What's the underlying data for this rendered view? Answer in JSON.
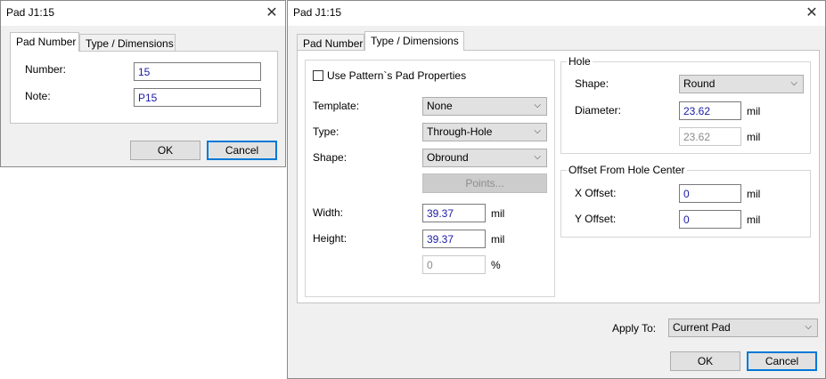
{
  "left_dialog": {
    "title": "Pad J1:15",
    "tabs": [
      "Pad Number",
      "Type / Dimensions"
    ],
    "fields": {
      "number_label": "Number:",
      "number_value": "15",
      "note_label": "Note:",
      "note_value": "P15"
    },
    "buttons": {
      "ok": "OK",
      "cancel": "Cancel"
    }
  },
  "right_dialog": {
    "title": "Pad J1:15",
    "tabs": [
      "Pad Number",
      "Type / Dimensions"
    ],
    "use_pattern_label": "Use Pattern`s Pad Properties",
    "template_label": "Template:",
    "template_value": "None",
    "type_label": "Type:",
    "type_value": "Through-Hole",
    "shape_label": "Shape:",
    "shape_value": "Obround",
    "points_button": "Points...",
    "width_label": "Width:",
    "width_value": "39.37",
    "width_unit": "mil",
    "height_label": "Height:",
    "height_value": "39.37",
    "height_unit": "mil",
    "percent_value": "0",
    "percent_unit": "%",
    "hole": {
      "title": "Hole",
      "shape_label": "Shape:",
      "shape_value": "Round",
      "diameter_label": "Diameter:",
      "diameter_value": "23.62",
      "diameter_unit": "mil",
      "diameter2_value": "23.62",
      "diameter2_unit": "mil"
    },
    "offset": {
      "title": "Offset From Hole Center",
      "x_label": "X Offset:",
      "x_value": "0",
      "x_unit": "mil",
      "y_label": "Y Offset:",
      "y_value": "0",
      "y_unit": "mil"
    },
    "apply_to_label": "Apply To:",
    "apply_to_value": "Current Pad",
    "buttons": {
      "ok": "OK",
      "cancel": "Cancel"
    }
  },
  "icons": {
    "close": "close-icon",
    "dropdown": "chevron-down-icon"
  },
  "colors": {
    "accent": "#0078d7",
    "value_text": "#1a1aa6"
  }
}
